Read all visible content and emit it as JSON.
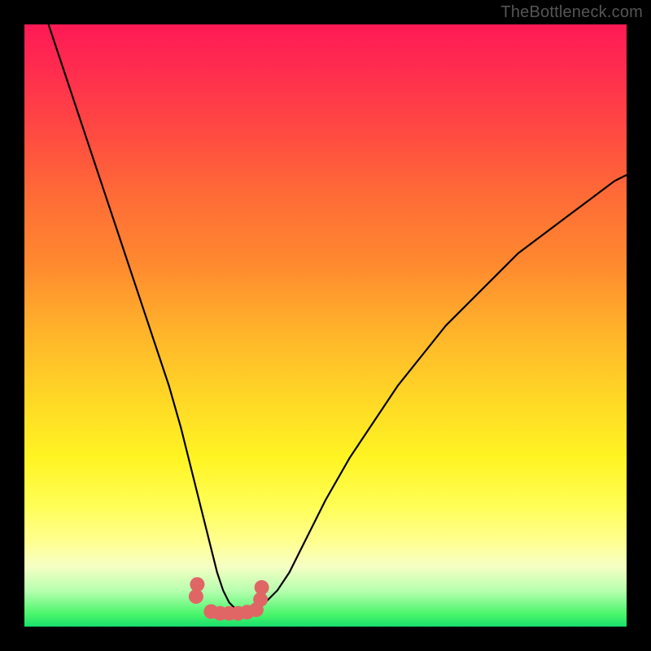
{
  "attribution": "TheBottleneck.com",
  "colors": {
    "frame": "#000000",
    "curve": "#000000",
    "markers": "#e06666",
    "gradient_top": "#ff1a55",
    "gradient_bottom": "#18e06c"
  },
  "chart_data": {
    "type": "line",
    "title": "",
    "xlabel": "",
    "ylabel": "",
    "xlim": [
      0,
      100
    ],
    "ylim": [
      0,
      100
    ],
    "series": [
      {
        "name": "bottleneck-curve",
        "x": [
          4,
          5,
          6,
          7,
          8,
          9,
          10,
          12,
          14,
          16,
          18,
          20,
          22,
          24,
          26,
          27,
          28,
          29,
          30,
          31,
          32,
          33,
          34,
          35,
          36,
          38,
          40,
          42,
          44,
          46,
          48,
          50,
          54,
          58,
          62,
          66,
          70,
          74,
          78,
          82,
          86,
          90,
          94,
          98,
          100
        ],
        "y": [
          100,
          97,
          94,
          91,
          88,
          85,
          82,
          76,
          70,
          64,
          58,
          52,
          46,
          40,
          33,
          29,
          25,
          21,
          17,
          13,
          9,
          6,
          4,
          3,
          3,
          3,
          4,
          6,
          9,
          13,
          17,
          21,
          28,
          34,
          40,
          45,
          50,
          54,
          58,
          62,
          65,
          68,
          71,
          74,
          75
        ]
      }
    ],
    "markers": {
      "name": "highlight-points",
      "x": [
        28.5,
        28.7,
        31,
        32.5,
        34,
        35.5,
        37,
        38.5,
        39.2,
        39.4
      ],
      "y": [
        5.0,
        7.0,
        2.5,
        2.2,
        2.2,
        2.2,
        2.4,
        2.8,
        4.5,
        6.5
      ]
    }
  }
}
